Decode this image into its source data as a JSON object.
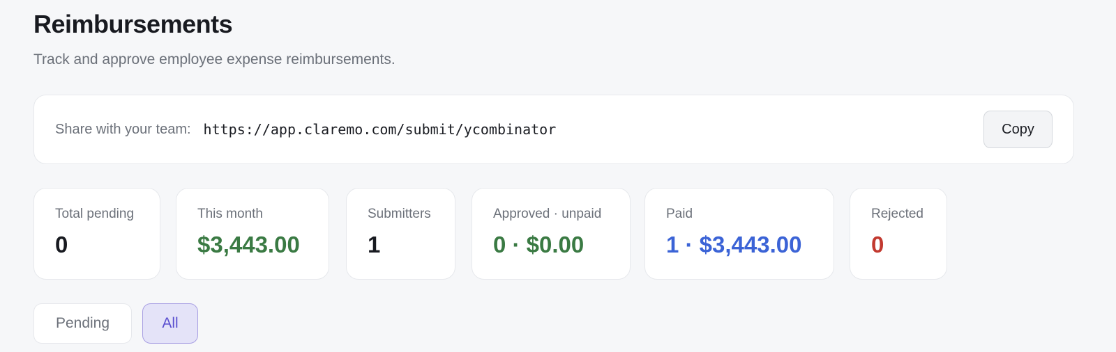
{
  "header": {
    "title": "Reimbursements",
    "subtitle": "Track and approve employee expense reimbursements."
  },
  "share": {
    "label": "Share with your team:",
    "url": "https://app.claremo.com/submit/ycombinator",
    "copy_label": "Copy"
  },
  "stats": [
    {
      "label": "Total pending",
      "value": "0",
      "color": "#181a20"
    },
    {
      "label": "This month",
      "value": "$3,443.00",
      "color": "#3a7a43"
    },
    {
      "label": "Submitters",
      "value": "1",
      "color": "#181a20"
    },
    {
      "label": "Approved · unpaid",
      "value": "0 · $0.00",
      "color": "#3a7a43"
    },
    {
      "label": "Paid",
      "value": "1 · $3,443.00",
      "color": "#3b63d6"
    },
    {
      "label": "Rejected",
      "value": "0",
      "color": "#c2392f"
    }
  ],
  "filters": {
    "tabs": [
      {
        "label": "Pending",
        "active": false
      },
      {
        "label": "All",
        "active": true
      }
    ]
  }
}
